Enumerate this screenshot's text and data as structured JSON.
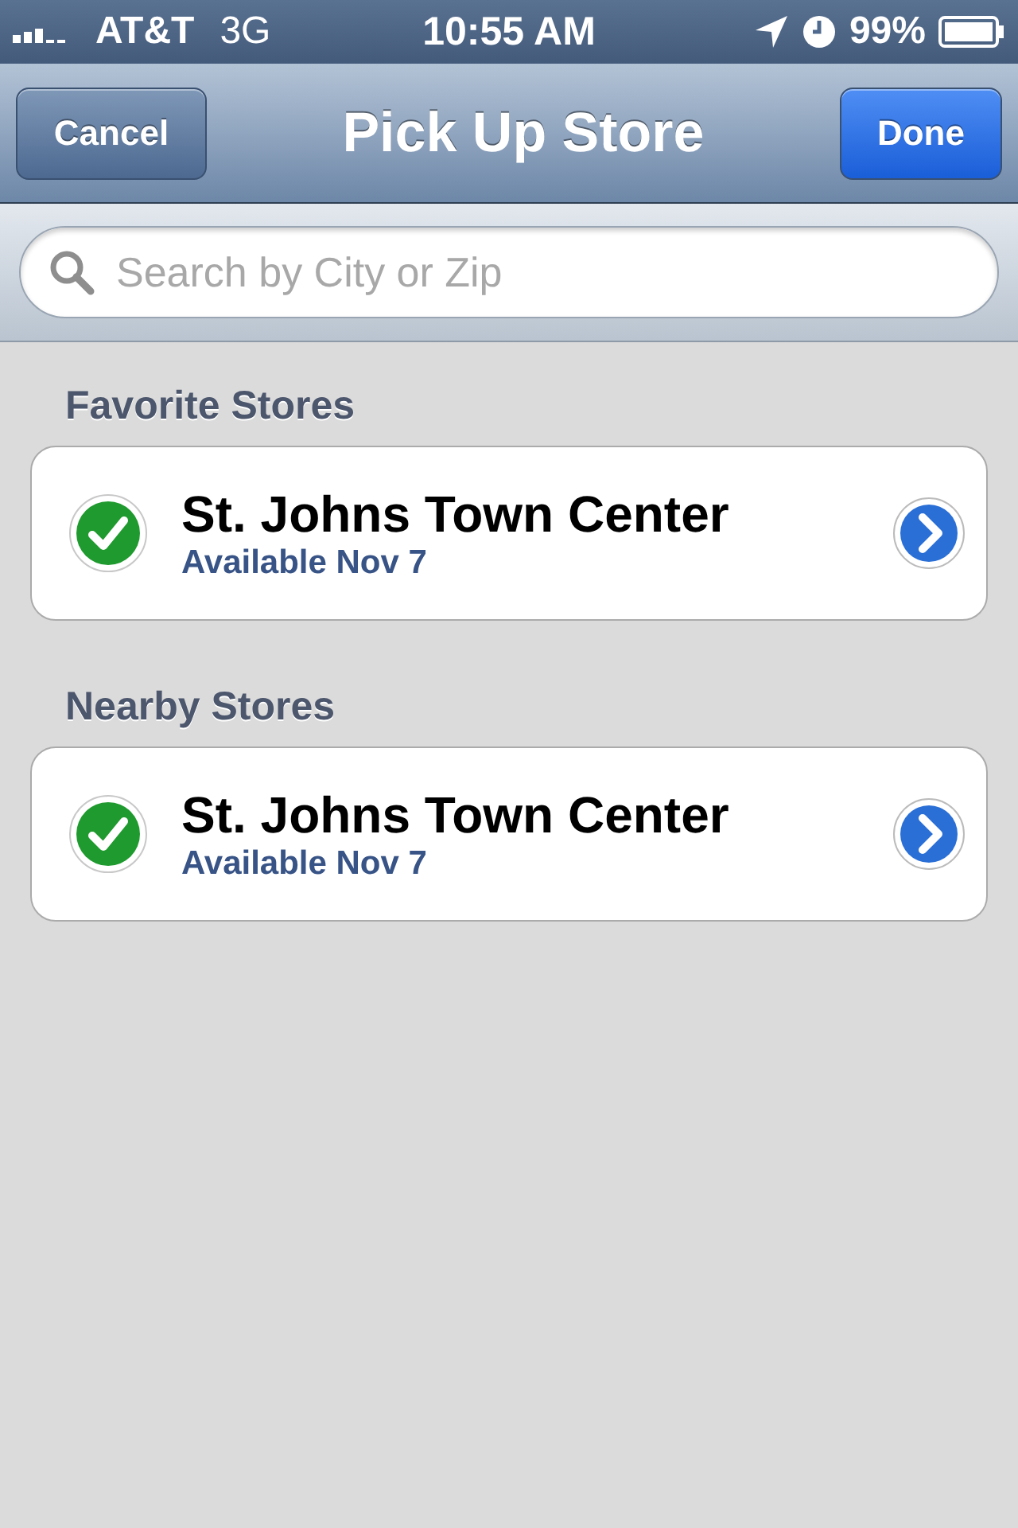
{
  "status_bar": {
    "carrier": "AT&T",
    "network": "3G",
    "time": "10:55 AM",
    "battery": "99%"
  },
  "nav_bar": {
    "left_button": "Cancel",
    "title": "Pick Up Store",
    "right_button": "Done"
  },
  "search": {
    "placeholder": "Search by City or Zip"
  },
  "sections": [
    {
      "title": "Favorite Stores",
      "rows": [
        {
          "name": "St. Johns Town Center",
          "availability": "Available Nov 7",
          "checked": true
        }
      ]
    },
    {
      "title": "Nearby Stores",
      "rows": [
        {
          "name": "St. Johns Town Center",
          "availability": "Available Nov 7",
          "checked": true
        }
      ]
    }
  ]
}
